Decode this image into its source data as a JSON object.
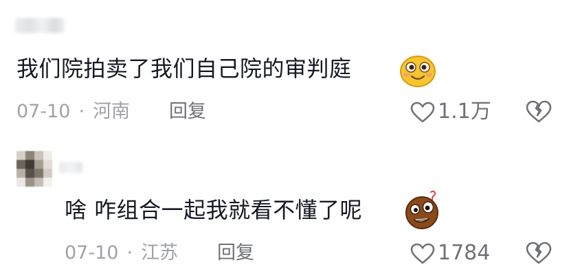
{
  "comments": [
    {
      "text": "我们院拍卖了我们自己院的审判庭",
      "date": "07-10",
      "separator": "·",
      "location": "河南",
      "reply_label": "回复",
      "likes": "1.1万",
      "emoji_icon": "smiling-face-emoji"
    },
    {
      "text": "啥 咋组合一起我就看不懂了呢",
      "date": "07-10",
      "separator": "·",
      "location": "江苏",
      "reply_label": "回复",
      "likes": "1784",
      "emoji_icon": "confused-face-emoji"
    }
  ],
  "colors": {
    "text": "#161823",
    "meta": "#9fa1a6",
    "icon": "#6f7177"
  }
}
